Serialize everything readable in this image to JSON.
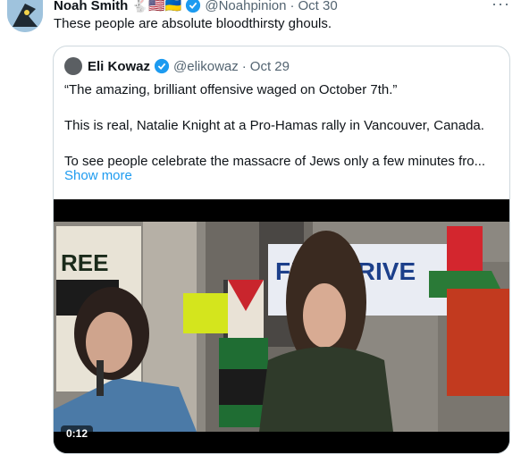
{
  "tweet": {
    "author_name": "Noah Smith",
    "author_handle": "@Noahpinion",
    "dot": "·",
    "date": "Oct 30",
    "emojis": "🐇🇺🇸🇺🇦",
    "text": "These people are absolute bloodthirsty ghouls.",
    "more": "···"
  },
  "quote": {
    "author_name": "Eli Kowaz",
    "author_handle": "@elikowaz",
    "dot": "·",
    "date": "Oct 29",
    "lines": [
      "“The amazing, brilliant offensive waged on October 7th.”",
      "This is real, Natalie Knight at a Pro-Hamas rally in Vancouver, Canada.",
      "To see people celebrate the massacre of Jews only a few minutes fro..."
    ],
    "show_more": "Show more",
    "video_time": "0:12",
    "sign_text": "FR    HE RIVE"
  },
  "colors": {
    "link": "#1d9bf0",
    "verified": "#1d9bf0",
    "muted": "#536471",
    "border": "#cfd9de"
  }
}
